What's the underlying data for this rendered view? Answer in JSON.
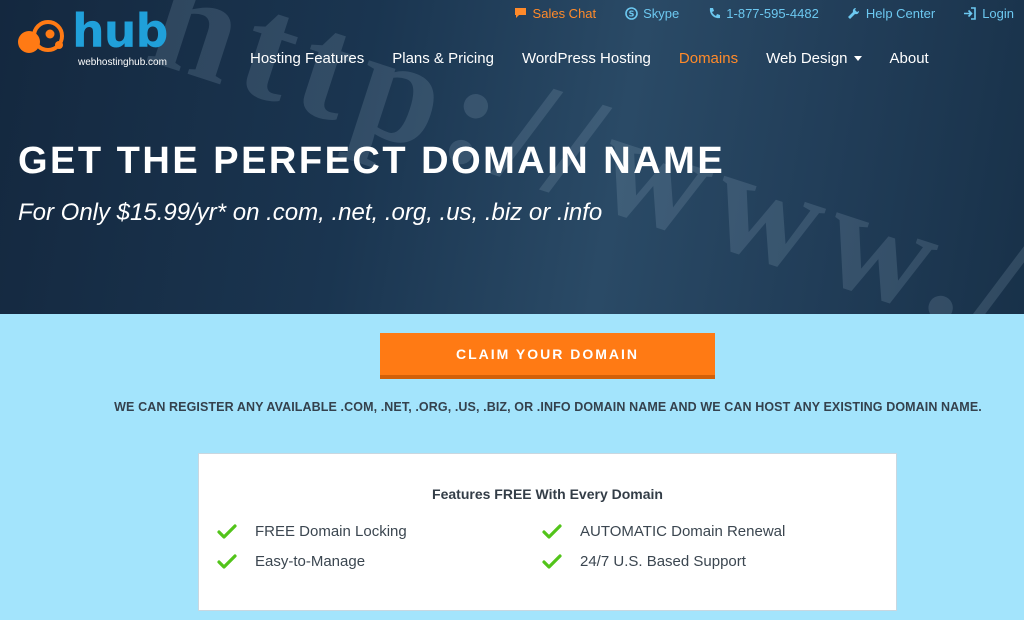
{
  "logo": {
    "word": "hub",
    "subtext": "webhostinghub.com"
  },
  "utility": {
    "sales_chat": "Sales Chat",
    "skype": "Skype",
    "phone": "1-877-595-4482",
    "help_center": "Help Center",
    "login": "Login"
  },
  "nav": {
    "items": [
      {
        "label": "Hosting Features"
      },
      {
        "label": "Plans & Pricing"
      },
      {
        "label": "WordPress Hosting"
      },
      {
        "label": "Domains"
      },
      {
        "label": "Web Design"
      },
      {
        "label": "About"
      }
    ],
    "active": "Domains"
  },
  "hero": {
    "texture_text": "http://www./",
    "headline": "GET THE PERFECT DOMAIN NAME",
    "subhead": "For Only $15.99/yr* on .com, .net, .org, .us, .biz or .info"
  },
  "cta": {
    "label": "CLAIM YOUR DOMAIN"
  },
  "register_note": "WE CAN REGISTER ANY AVAILABLE .COM, .NET, .ORG, .US, .BIZ, OR .INFO DOMAIN NAME AND WE CAN HOST ANY EXISTING DOMAIN NAME.",
  "features": {
    "title": "Features FREE With Every Domain",
    "items": [
      {
        "label": "FREE Domain Locking"
      },
      {
        "label": "Easy-to-Manage"
      },
      {
        "label": "AUTOMATIC Domain Renewal"
      },
      {
        "label": "24/7 U.S. Based Support"
      }
    ]
  },
  "colors": {
    "accent_orange": "#ff7a14",
    "brand_blue": "#20a0da",
    "hero_navy": "#1a3550",
    "page_bg": "#a3e4fc",
    "check_green": "#52c41a"
  },
  "icons": {
    "sales_chat": "chat-bubble-icon",
    "skype": "skype-icon",
    "phone": "phone-icon",
    "help_center": "wrench-icon",
    "login": "login-icon",
    "feature_check": "checkmark-icon"
  }
}
